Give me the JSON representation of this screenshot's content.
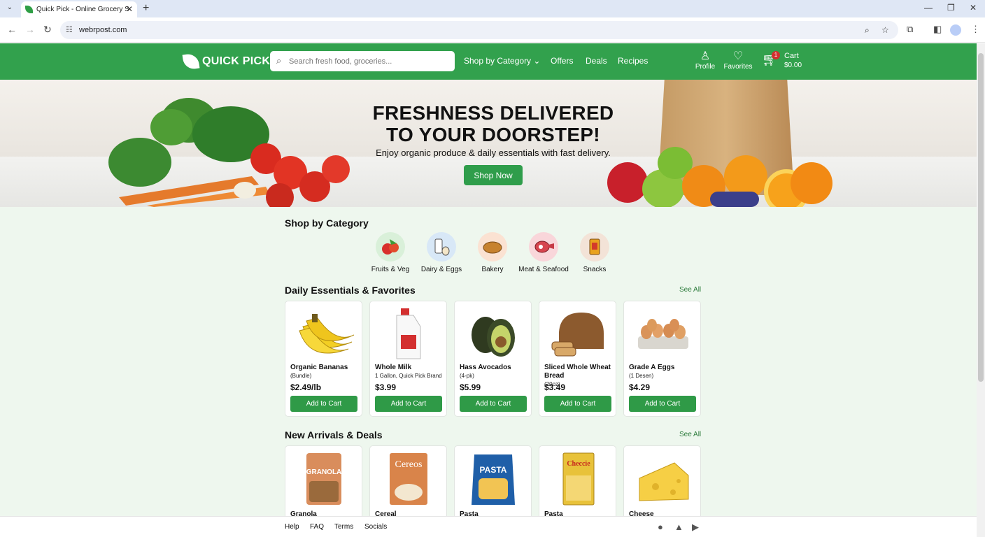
{
  "browser": {
    "tab_title": "Quick Pick - Online Grocery S",
    "url": "webrpost.com"
  },
  "header": {
    "brand": "QUICK PICK",
    "search_placeholder": "Search fresh food, groceries...",
    "nav": [
      "Shop by Category",
      "Offers",
      "Deals",
      "Recipes"
    ],
    "profile_label": "Profile",
    "favorites_label": "Favorites",
    "cart_label": "Cart",
    "cart_total": "$0.00",
    "cart_count": "1"
  },
  "hero": {
    "title_line1": "FRESHNESS DELIVERED",
    "title_line2": "TO YOUR DOORSTEP!",
    "subtitle": "Enjoy organic produce & daily essentials with fast delivery.",
    "cta": "Shop Now"
  },
  "categories": {
    "heading": "Shop by Category",
    "items": [
      {
        "label": "Fruits & Veg",
        "color": "#d9f0d9",
        "icon": "fruits-veg-icon"
      },
      {
        "label": "Dairy & Eggs",
        "color": "#d8e8f7",
        "icon": "dairy-eggs-icon"
      },
      {
        "label": "Bakery",
        "color": "#fbe2d2",
        "icon": "bakery-icon"
      },
      {
        "label": "Meat & Seafood",
        "color": "#f9d6da",
        "icon": "meat-seafood-icon"
      },
      {
        "label": "Snacks",
        "color": "#f3e3d7",
        "icon": "snacks-icon"
      }
    ]
  },
  "essentials": {
    "heading": "Daily Essentials & Favorites",
    "see_all": "See All",
    "products": [
      {
        "name": "Organic Bananas",
        "sub": "(Bundle)",
        "price": "$2.49/lb",
        "button": "Add to Cart"
      },
      {
        "name": "Whole Milk",
        "sub": "1 Gallon, Quick Pick Brand",
        "price": "$3.99",
        "button": "Add to Cart"
      },
      {
        "name": "Hass Avocados",
        "sub": "(4-pk)",
        "price": "$5.99",
        "button": "Add to Cart"
      },
      {
        "name": "Sliced Whole Wheat Bread",
        "sub": "(20oz)",
        "price": "$3.49",
        "button": "Add to Cart"
      },
      {
        "name": "Grade A Eggs",
        "sub": "(1 Desen)",
        "price": "$4.29",
        "button": "Add to Cart"
      }
    ]
  },
  "arrivals": {
    "heading": "New Arrivals & Deals",
    "see_all": "See All",
    "products": [
      {
        "name": "Granola",
        "pack_text": "GRANOLA"
      },
      {
        "name": "Cereal",
        "pack_text": "Cereos"
      },
      {
        "name": "Pasta",
        "pack_text": "PASTA"
      },
      {
        "name": "Pasta",
        "pack_text": "Checcie"
      },
      {
        "name": "Cheese",
        "pack_text": ""
      }
    ]
  },
  "footer": {
    "links": [
      "Help",
      "FAQ",
      "Terms",
      "Socials"
    ]
  }
}
